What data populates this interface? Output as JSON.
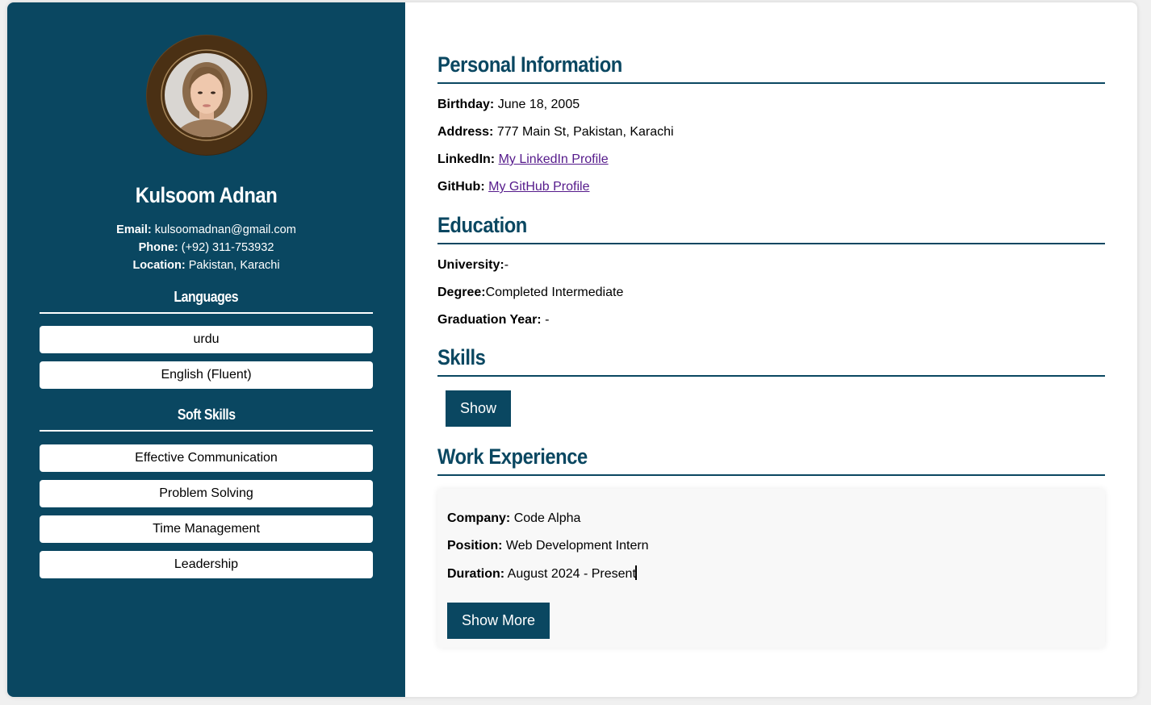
{
  "sidebar": {
    "name": "Kulsoom Adnan",
    "contact": {
      "email_label": "Email:",
      "email": "kulsoomadnan@gmail.com",
      "phone_label": "Phone:",
      "phone": "(+92) 311-753932",
      "location_label": "Location:",
      "location": "Pakistan, Karachi"
    },
    "languages_heading": "Languages",
    "languages": [
      "urdu",
      "English (Fluent)"
    ],
    "soft_skills_heading": "Soft Skills",
    "soft_skills": [
      "Effective Communication",
      "Problem Solving",
      "Time Management",
      "Leadership"
    ]
  },
  "personal": {
    "heading": "Personal Information",
    "birthday_label": "Birthday:",
    "birthday": "June 18, 2005",
    "address_label": "Address:",
    "address": "777 Main St, Pakistan, Karachi",
    "linkedin_label": "LinkedIn:",
    "linkedin_link": "My LinkedIn Profile",
    "github_label": "GitHub:",
    "github_link": "My GitHub Profile"
  },
  "education": {
    "heading": "Education",
    "university_label": "University:",
    "university": "-",
    "degree_label": "Degree:",
    "degree": "Completed Intermediate",
    "graduation_label": "Graduation Year:",
    "graduation": "-"
  },
  "skills": {
    "heading": "Skills",
    "show_label": "Show"
  },
  "work": {
    "heading": "Work Experience",
    "company_label": "Company:",
    "company": "Code Alpha",
    "position_label": "Position:",
    "position": "Web Development Intern",
    "duration_label": "Duration:",
    "duration": "August 2024 - Present",
    "show_more_label": "Show More"
  },
  "colors": {
    "primary": "#0a4761",
    "link": "#551a8b",
    "background": "#f0f0f0"
  }
}
